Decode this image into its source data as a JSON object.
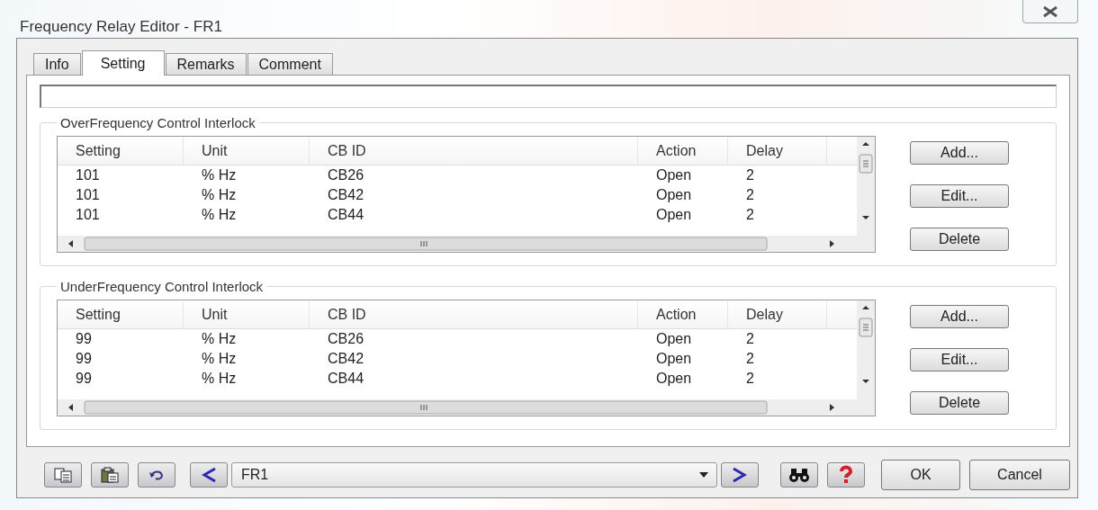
{
  "window": {
    "title": "Frequency Relay Editor - FR1"
  },
  "tabs": [
    {
      "label": "Info",
      "selected": false
    },
    {
      "label": "Setting",
      "selected": true
    },
    {
      "label": "Remarks",
      "selected": false
    },
    {
      "label": "Comment",
      "selected": false
    }
  ],
  "groups": [
    {
      "title": "OverFrequency Control Interlock",
      "columns": [
        "Setting",
        "Unit",
        "CB ID",
        "Action",
        "Delay"
      ],
      "rows": [
        [
          "101",
          "% Hz",
          "CB26",
          "Open",
          "2"
        ],
        [
          "101",
          "% Hz",
          "CB42",
          "Open",
          "2"
        ],
        [
          "101",
          "% Hz",
          "CB44",
          "Open",
          "2"
        ]
      ],
      "buttons": [
        "Add...",
        "Edit...",
        "Delete"
      ]
    },
    {
      "title": "UnderFrequency Control Interlock",
      "columns": [
        "Setting",
        "Unit",
        "CB ID",
        "Action",
        "Delay"
      ],
      "rows": [
        [
          "99",
          "% Hz",
          "CB26",
          "Open",
          "2"
        ],
        [
          "99",
          "% Hz",
          "CB42",
          "Open",
          "2"
        ],
        [
          "99",
          "% Hz",
          "CB44",
          "Open",
          "2"
        ]
      ],
      "buttons": [
        "Add...",
        "Edit...",
        "Delete"
      ]
    }
  ],
  "selector": {
    "value": "FR1"
  },
  "buttons": [
    "OK",
    "Cancel"
  ]
}
